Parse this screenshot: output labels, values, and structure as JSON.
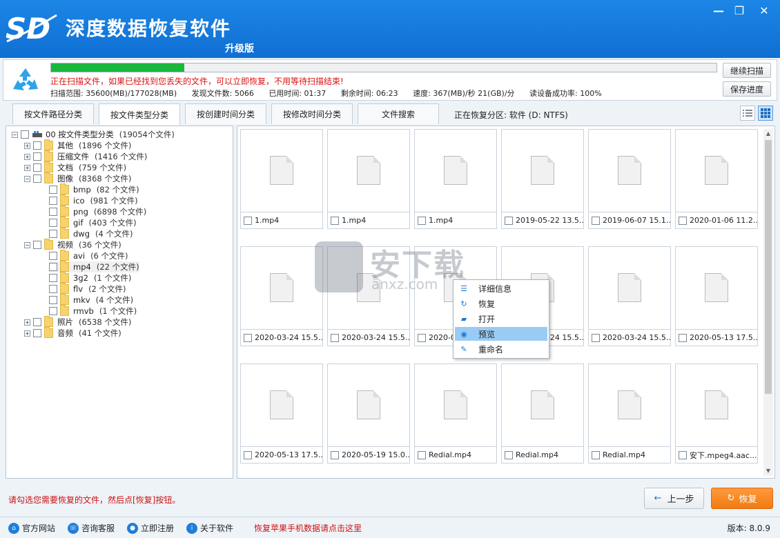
{
  "app": {
    "title": "深度数据恢复软件",
    "edition": "升级版",
    "logo_text": "SD"
  },
  "window_controls": {
    "minimize": "—",
    "restore": "❐",
    "close": "✕"
  },
  "scan": {
    "progress_percent": 20,
    "message": "正在扫描文件，如果已经找到您丢失的文件，可以立即恢复，不用等待扫描结束!",
    "range": "扫描范围: 35600(MB)/177028(MB)",
    "found": "发现文件数: 5066",
    "elapsed": "已用时间: 01:37",
    "remaining": "剩余时间: 06:23",
    "speed": "速度: 367(MB)/秒  21(GB)/分",
    "read_rate": "读设备成功率: 100%",
    "continue_label": "继续扫描",
    "save_label": "保存进度"
  },
  "tabs": [
    {
      "label": "按文件路径分类"
    },
    {
      "label": "按文件类型分类"
    },
    {
      "label": "按创建时间分类"
    },
    {
      "label": "按修改时间分类"
    },
    {
      "label": "文件搜索"
    }
  ],
  "partition": "正在恢复分区: 软件 (D: NTFS)",
  "tree": {
    "root": {
      "label": "00  按文件类型分类",
      "count": "(19054个文件)"
    },
    "nodes": [
      {
        "label": "其他",
        "count": "(1896 个文件)"
      },
      {
        "label": "压缩文件",
        "count": "(1416 个文件)"
      },
      {
        "label": "文档",
        "count": "(759 个文件)"
      },
      {
        "label": "图像",
        "count": "(8368 个文件)"
      },
      {
        "label": "bmp",
        "count": "(82 个文件)"
      },
      {
        "label": "ico",
        "count": "(981 个文件)"
      },
      {
        "label": "png",
        "count": "(6898 个文件)"
      },
      {
        "label": "gif",
        "count": "(403 个文件)"
      },
      {
        "label": "dwg",
        "count": "(4 个文件)"
      },
      {
        "label": "视频",
        "count": "(36 个文件)"
      },
      {
        "label": "avi",
        "count": "(6 个文件)"
      },
      {
        "label": "mp4",
        "count": "(22 个文件)"
      },
      {
        "label": "3g2",
        "count": "(1 个文件)"
      },
      {
        "label": "flv",
        "count": "(2 个文件)"
      },
      {
        "label": "mkv",
        "count": "(4 个文件)"
      },
      {
        "label": "rmvb",
        "count": "(1 个文件)"
      },
      {
        "label": "照片",
        "count": "(6538 个文件)"
      },
      {
        "label": "音频",
        "count": "(41 个文件)"
      }
    ]
  },
  "files": [
    "1.mp4",
    "1.mp4",
    "1.mp4",
    "2019-05-22 13.5...",
    "2019-06-07 15.1...",
    "2020-01-06 11.2...",
    "2020-03-24 15.5...",
    "2020-03-24 15.5...",
    "2020-0",
    "2020-03-24 15.5...",
    "2020-03-24 15.5...",
    "2020-05-13 17.5...",
    "2020-05-13 17.5...",
    "2020-05-19 15.0...",
    "Redial.mp4",
    "Redial.mp4",
    "Redial.mp4",
    "安下.mpeg4.aac...."
  ],
  "context_menu": [
    {
      "label": "详细信息",
      "icon": "details-icon"
    },
    {
      "label": "恢复",
      "icon": "restore-icon"
    },
    {
      "label": "打开",
      "icon": "open-folder-icon"
    },
    {
      "label": "预览",
      "icon": "preview-icon"
    },
    {
      "label": "重命名",
      "icon": "rename-icon"
    }
  ],
  "watermark": {
    "text": "安下载",
    "sub": "anxz.com"
  },
  "footer": {
    "hint": "请勾选您需要恢复的文件，然后点[恢复]按钮。",
    "prev_label": "上一步",
    "recover_label": "恢复"
  },
  "statusbar": {
    "links": [
      {
        "label": "官方网站",
        "icon": "home-icon"
      },
      {
        "label": "咨询客服",
        "icon": "support-icon"
      },
      {
        "label": "立即注册",
        "icon": "user-icon"
      },
      {
        "label": "关于软件",
        "icon": "info-icon"
      }
    ],
    "ios_promo": "恢复苹果手机数据请点击这里",
    "version": "版本: 8.0.9"
  },
  "colors": {
    "titlebar": "#1976d9",
    "progress": "#18b83e",
    "warning": "#cc1111",
    "recover_button": "#f07b11",
    "menu_highlight": "#99ccf4"
  }
}
